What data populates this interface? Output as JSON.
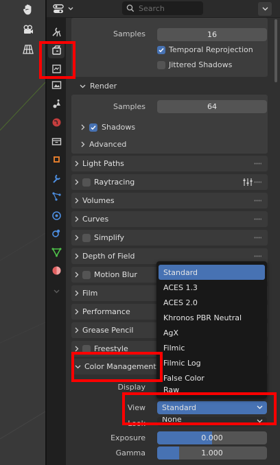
{
  "colors": {
    "accent": "#4772b3",
    "highlight_box": "#ff0000",
    "background": "#303030",
    "tab_bar": "#1f1f1f"
  },
  "viewport": {
    "tools": [
      "hand-icon",
      "camera-icon",
      "grid-icon"
    ]
  },
  "header": {
    "search_placeholder": "Search",
    "editor_icon": "properties-editor-icon"
  },
  "tabs": [
    {
      "icon": "tool-icon",
      "active": false
    },
    {
      "icon": "render-icon",
      "active": true
    },
    {
      "icon": "output-icon",
      "active": false
    },
    {
      "icon": "view-layer-icon",
      "active": false
    },
    {
      "icon": "scene-icon",
      "active": false
    },
    {
      "icon": "world-icon",
      "active": false
    },
    {
      "icon": "collection-icon",
      "active": false
    },
    {
      "icon": "object-icon",
      "active": false
    },
    {
      "icon": "modifiers-icon",
      "active": false
    },
    {
      "icon": "particles-icon",
      "active": false
    },
    {
      "icon": "physics-icon",
      "active": false
    },
    {
      "icon": "constraints-icon",
      "active": false
    },
    {
      "icon": "data-icon",
      "active": false
    },
    {
      "icon": "material-icon",
      "active": false
    },
    {
      "icon": "chevron-down-icon",
      "active": false
    }
  ],
  "viewport_settings": {
    "samples_label": "Samples",
    "samples_value": "16",
    "temporal_reprojection": {
      "label": "Temporal Reprojection",
      "checked": true
    },
    "jittered_shadows": {
      "label": "Jittered Shadows",
      "checked": false
    }
  },
  "render_sub": {
    "title": "Render",
    "samples_label": "Samples",
    "samples_value": "64",
    "shadows": {
      "label": "Shadows",
      "checked": true
    },
    "advanced": "Advanced"
  },
  "sections": [
    {
      "label": "Light Paths",
      "checkbox": null
    },
    {
      "label": "Raytracing",
      "checkbox": false,
      "extra_icon": "settings-sliders-icon"
    },
    {
      "label": "Volumes",
      "checkbox": null
    },
    {
      "label": "Curves",
      "checkbox": null
    },
    {
      "label": "Simplify",
      "checkbox": false
    },
    {
      "label": "Depth of Field",
      "checkbox": null
    },
    {
      "label": "Motion Blur",
      "checkbox": false
    },
    {
      "label": "Film",
      "checkbox": null
    },
    {
      "label": "Performance",
      "checkbox": null
    },
    {
      "label": "Grease Pencil",
      "checkbox": null
    },
    {
      "label": "Freestyle",
      "checkbox": false
    }
  ],
  "color_management": {
    "title": "Color Management",
    "display_label": "Display",
    "view_label": "View",
    "view_value": "Standard",
    "look_label": "Look",
    "look_value": "None",
    "exposure_label": "Exposure",
    "exposure_value": "0.000",
    "exposure_fraction": 0.5,
    "gamma_label": "Gamma",
    "gamma_value": "1.000",
    "gamma_fraction": 0.2
  },
  "view_menu": {
    "items": [
      "Standard",
      "ACES 1.3",
      "ACES 2.0",
      "Khronos PBR Neutral",
      "AgX",
      "Filmic",
      "Filmic Log",
      "False Color",
      "Raw"
    ],
    "selected": "Standard"
  }
}
